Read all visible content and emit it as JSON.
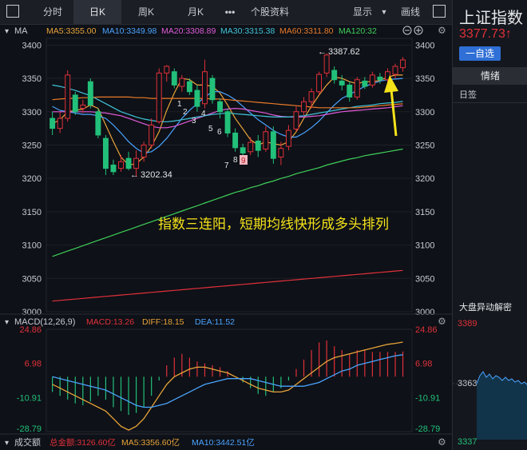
{
  "toolbar": {
    "tabs": [
      "分时",
      "日K",
      "周K",
      "月K"
    ],
    "more_label": "•••",
    "stock_data_label": "个股资料",
    "display_label": "显示",
    "draw_label": "画线"
  },
  "main_chart": {
    "indicator_label": "MA",
    "ma_values": [
      {
        "label": "MA5:3355.00",
        "color": "#e8a33a"
      },
      {
        "label": "MA10:3349.98",
        "color": "#4aa3ff"
      },
      {
        "label": "MA20:3308.89",
        "color": "#e05ad8"
      },
      {
        "label": "MA30:3315.38",
        "color": "#3fc3d8"
      },
      {
        "label": "MA60:3311.80",
        "color": "#e87a2a"
      },
      {
        "label": "MA120:32",
        "color": "#3fcf5a"
      }
    ],
    "y_ticks": [
      "3400",
      "3350",
      "3300",
      "3250",
      "3200",
      "3150",
      "3100",
      "3050",
      "3000"
    ],
    "high_annotation": "3387.62",
    "low_annotation": "3202.34",
    "numbered_labels": [
      "1",
      "2",
      "3",
      "4",
      "5",
      "6",
      "7",
      "8",
      "9"
    ],
    "annotation_text": "指数三连阳，短期均线快形成多头排列"
  },
  "macd": {
    "label": "MACD(12,26,9)",
    "macd_value": "MACD:13.26",
    "diff_value": "DIFF:18.15",
    "dea_value": "DEA:11.52",
    "y_ticks": [
      "24.86",
      "6.98",
      "-10.91",
      "-28.79"
    ]
  },
  "volume": {
    "label": "成交额",
    "total": "总金额:3126.60亿",
    "ma5": "MA5:3356.60亿",
    "ma10": "MA10:3442.51亿"
  },
  "right_panel": {
    "title": "上证指数",
    "price": "3377.73",
    "arrow": "↑",
    "watchlist_button": "一自选",
    "sentiment_tab": "情绪",
    "daily_label": "日签",
    "market_move_label": "大盘异动解密",
    "mini_ticks": [
      "3389",
      "3363",
      "3337"
    ]
  },
  "colors": {
    "up": "#e0303a",
    "down": "#22c07a",
    "annotation": "#f5e31a",
    "background": "#0e1117"
  },
  "chart_data": [
    {
      "type": "candlestick",
      "title": "",
      "ylim": [
        3000,
        3410
      ],
      "y_ticks": [
        3000,
        3050,
        3100,
        3150,
        3200,
        3250,
        3300,
        3350,
        3400
      ],
      "candles": [
        {
          "o": 3290,
          "c": 3275,
          "h": 3300,
          "l": 3265
        },
        {
          "o": 3275,
          "c": 3290,
          "h": 3300,
          "l": 3268
        },
        {
          "o": 3290,
          "c": 3355,
          "h": 3362,
          "l": 3285
        },
        {
          "o": 3325,
          "c": 3300,
          "h": 3330,
          "l": 3295
        },
        {
          "o": 3305,
          "c": 3310,
          "h": 3318,
          "l": 3298
        },
        {
          "o": 3345,
          "c": 3310,
          "h": 3350,
          "l": 3305
        },
        {
          "o": 3300,
          "c": 3265,
          "h": 3305,
          "l": 3260
        },
        {
          "o": 3260,
          "c": 3215,
          "h": 3265,
          "l": 3205
        },
        {
          "o": 3220,
          "c": 3210,
          "h": 3228,
          "l": 3205
        },
        {
          "o": 3215,
          "c": 3225,
          "h": 3235,
          "l": 3210
        },
        {
          "o": 3230,
          "c": 3215,
          "h": 3240,
          "l": 3212
        },
        {
          "o": 3215,
          "c": 3230,
          "h": 3242,
          "l": 3202.34
        },
        {
          "o": 3232,
          "c": 3250,
          "h": 3255,
          "l": 3225
        },
        {
          "o": 3250,
          "c": 3280,
          "h": 3290,
          "l": 3245
        },
        {
          "o": 3285,
          "c": 3358,
          "h": 3365,
          "l": 3282
        },
        {
          "o": 3358,
          "c": 3368,
          "h": 3370,
          "l": 3345
        },
        {
          "o": 3360,
          "c": 3340,
          "h": 3365,
          "l": 3335
        },
        {
          "o": 3338,
          "c": 3350,
          "h": 3355,
          "l": 3330
        },
        {
          "o": 3345,
          "c": 3330,
          "h": 3350,
          "l": 3325
        },
        {
          "o": 3332,
          "c": 3308,
          "h": 3340,
          "l": 3300
        },
        {
          "o": 3312,
          "c": 3360,
          "h": 3378,
          "l": 3305
        },
        {
          "o": 3350,
          "c": 3318,
          "h": 3355,
          "l": 3312
        },
        {
          "o": 3315,
          "c": 3300,
          "h": 3320,
          "l": 3290
        },
        {
          "o": 3300,
          "c": 3268,
          "h": 3305,
          "l": 3262
        },
        {
          "o": 3268,
          "c": 3246,
          "h": 3275,
          "l": 3240
        },
        {
          "o": 3246,
          "c": 3238,
          "h": 3252,
          "l": 3228
        },
        {
          "o": 3240,
          "c": 3254,
          "h": 3262,
          "l": 3235
        },
        {
          "o": 3256,
          "c": 3242,
          "h": 3265,
          "l": 3232
        },
        {
          "o": 3244,
          "c": 3270,
          "h": 3278,
          "l": 3240
        },
        {
          "o": 3270,
          "c": 3230,
          "h": 3278,
          "l": 3222
        },
        {
          "o": 3232,
          "c": 3245,
          "h": 3255,
          "l": 3220
        },
        {
          "o": 3248,
          "c": 3272,
          "h": 3280,
          "l": 3242
        },
        {
          "o": 3274,
          "c": 3300,
          "h": 3308,
          "l": 3270
        },
        {
          "o": 3300,
          "c": 3315,
          "h": 3322,
          "l": 3295
        },
        {
          "o": 3315,
          "c": 3330,
          "h": 3335,
          "l": 3305
        },
        {
          "o": 3330,
          "c": 3356,
          "h": 3360,
          "l": 3325
        },
        {
          "o": 3358,
          "c": 3385,
          "h": 3387.62,
          "l": 3352
        },
        {
          "o": 3362,
          "c": 3348,
          "h": 3368,
          "l": 3342
        },
        {
          "o": 3346,
          "c": 3340,
          "h": 3355,
          "l": 3332
        },
        {
          "o": 3340,
          "c": 3322,
          "h": 3345,
          "l": 3315
        },
        {
          "o": 3322,
          "c": 3348,
          "h": 3352,
          "l": 3318
        },
        {
          "o": 3346,
          "c": 3338,
          "h": 3352,
          "l": 3334
        },
        {
          "o": 3340,
          "c": 3355,
          "h": 3360,
          "l": 3336
        },
        {
          "o": 3352,
          "c": 3348,
          "h": 3358,
          "l": 3342
        },
        {
          "o": 3348,
          "c": 3360,
          "h": 3365,
          "l": 3344
        },
        {
          "o": 3356,
          "c": 3368,
          "h": 3372,
          "l": 3350
        },
        {
          "o": 3366,
          "c": 3377.73,
          "h": 3382,
          "l": 3360
        }
      ],
      "series": [
        {
          "name": "MA5",
          "color": "#e8a33a",
          "values": [
            3282,
            3288,
            3300,
            3302,
            3304,
            3310,
            3305,
            3280,
            3255,
            3232,
            3220,
            3222,
            3232,
            3248,
            3270,
            3302,
            3328,
            3350,
            3348,
            3340,
            3340,
            3338,
            3328,
            3310,
            3290,
            3274,
            3258,
            3250,
            3255,
            3252,
            3250,
            3255,
            3270,
            3290,
            3308,
            3325,
            3340,
            3352,
            3350,
            3345,
            3342,
            3345,
            3345,
            3347,
            3352,
            3355,
            3355
          ]
        },
        {
          "name": "MA10",
          "color": "#4aa3ff",
          "values": [
            3308,
            3302,
            3300,
            3298,
            3296,
            3296,
            3294,
            3290,
            3280,
            3268,
            3255,
            3245,
            3238,
            3240,
            3248,
            3260,
            3275,
            3290,
            3302,
            3312,
            3322,
            3330,
            3330,
            3325,
            3318,
            3308,
            3298,
            3288,
            3280,
            3272,
            3266,
            3262,
            3262,
            3268,
            3276,
            3286,
            3298,
            3310,
            3320,
            3326,
            3332,
            3338,
            3342,
            3346,
            3348,
            3349,
            3349.98
          ]
        },
        {
          "name": "MA20",
          "color": "#e05ad8",
          "values": [
            3300,
            3300,
            3300,
            3300,
            3300,
            3300,
            3299,
            3298,
            3296,
            3294,
            3290,
            3286,
            3282,
            3278,
            3276,
            3276,
            3278,
            3282,
            3286,
            3290,
            3294,
            3298,
            3302,
            3304,
            3305,
            3304,
            3302,
            3300,
            3298,
            3295,
            3293,
            3292,
            3292,
            3292,
            3293,
            3294,
            3296,
            3298,
            3300,
            3301,
            3302,
            3303,
            3304,
            3305,
            3306,
            3307.5,
            3308.89
          ]
        },
        {
          "name": "MA30",
          "color": "#3fc3d8",
          "values": [
            3340,
            3338,
            3335,
            3332,
            3328,
            3324,
            3318,
            3312,
            3306,
            3300,
            3296,
            3292,
            3289,
            3287,
            3285,
            3285,
            3286,
            3288,
            3290,
            3292,
            3294,
            3296,
            3297,
            3298,
            3297,
            3296,
            3295,
            3294,
            3293,
            3292,
            3292,
            3292,
            3293,
            3294,
            3296,
            3298,
            3300,
            3302,
            3304,
            3306,
            3308,
            3309,
            3310,
            3312,
            3313,
            3314,
            3315.38
          ]
        },
        {
          "name": "MA60",
          "color": "#e87a2a",
          "values": [
            3318,
            3319,
            3320,
            3320,
            3321,
            3321,
            3322,
            3322,
            3322,
            3322,
            3322,
            3321,
            3321,
            3320,
            3320,
            3320,
            3320,
            3320,
            3320,
            3320,
            3320,
            3319,
            3319,
            3318,
            3317,
            3316,
            3315,
            3314,
            3313,
            3312,
            3311,
            3310,
            3309,
            3308,
            3307,
            3306,
            3306,
            3306,
            3306,
            3306,
            3306,
            3307,
            3308,
            3309,
            3310,
            3311,
            3311.8
          ]
        },
        {
          "name": "MA120",
          "color": "#3fcf5a",
          "values": [
            3083,
            3087,
            3091,
            3095,
            3099,
            3103,
            3107,
            3111,
            3115,
            3119,
            3123,
            3127,
            3131,
            3135,
            3139,
            3143,
            3147,
            3151,
            3155,
            3159,
            3163,
            3167,
            3171,
            3175,
            3179,
            3182,
            3186,
            3189,
            3193,
            3196,
            3200,
            3203,
            3207,
            3210,
            3213,
            3216,
            3220,
            3223,
            3226,
            3229,
            3231,
            3234,
            3236,
            3238,
            3240,
            3242,
            3244
          ]
        },
        {
          "name": "MA250",
          "color": "#e0303a",
          "values": [
            3016,
            3017,
            3018,
            3019,
            3020,
            3021,
            3022,
            3023,
            3024,
            3025,
            3026,
            3027,
            3028,
            3029,
            3030,
            3031,
            3032,
            3033,
            3034,
            3035,
            3036,
            3037,
            3038,
            3039,
            3040,
            3041,
            3042,
            3043,
            3044,
            3045,
            3046,
            3047,
            3048,
            3049,
            3050,
            3051,
            3052,
            3053,
            3054,
            3055,
            3056,
            3057,
            3058,
            3059,
            3060,
            3061,
            3062
          ]
        }
      ]
    },
    {
      "type": "bar",
      "title": "MACD(12,26,9)",
      "ylim": [
        -28.79,
        24.86
      ],
      "macd": [
        -8,
        -10,
        -12,
        -14,
        -15,
        -13,
        -10,
        -12,
        -16,
        -18,
        -20,
        -19,
        -16,
        -10,
        -2,
        6,
        10,
        12,
        10,
        8,
        7,
        6,
        5,
        3,
        0,
        -3,
        -6,
        -9,
        -10,
        -8,
        -6,
        -2,
        4,
        9,
        14,
        18,
        19,
        16,
        14,
        12,
        14,
        14,
        13,
        13,
        13,
        13,
        13.26
      ],
      "diff": [
        -4,
        -6,
        -8,
        -10,
        -12,
        -14,
        -16,
        -18,
        -22,
        -26,
        -28,
        -26,
        -22,
        -16,
        -10,
        -4,
        0,
        2,
        4,
        5,
        5,
        4,
        3,
        2,
        0,
        -2,
        -4,
        -6,
        -7,
        -8,
        -8,
        -7,
        -4,
        -1,
        2,
        5,
        8,
        10,
        11,
        12,
        13,
        14,
        15,
        16,
        17,
        17.5,
        18.15
      ],
      "dea": [
        0,
        -1,
        -2,
        -3,
        -4,
        -5,
        -6,
        -7,
        -9,
        -11,
        -13,
        -15,
        -16,
        -16,
        -15,
        -14,
        -12,
        -10,
        -8,
        -6,
        -4,
        -3,
        -2,
        -1,
        -1,
        -1,
        -1,
        -2,
        -3,
        -4,
        -5,
        -5,
        -5,
        -5,
        -4,
        -3,
        -1,
        1,
        3,
        4,
        6,
        7,
        8,
        9,
        10,
        11,
        11.52
      ]
    }
  ]
}
